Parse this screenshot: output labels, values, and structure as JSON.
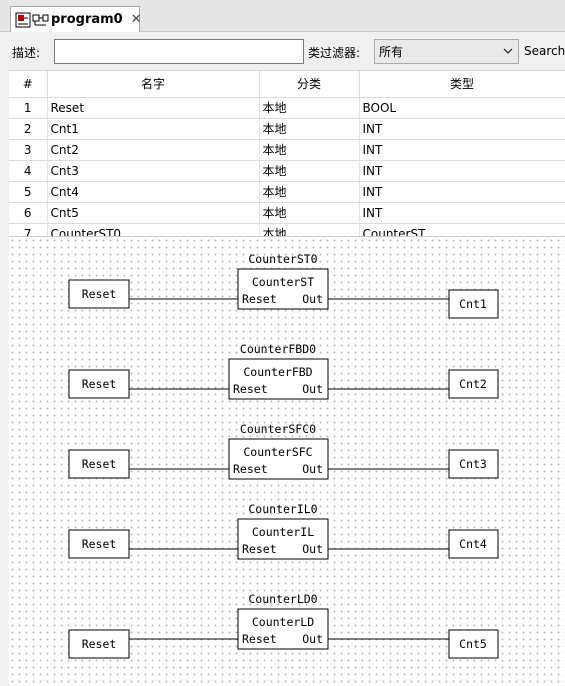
{
  "tab": {
    "label": "program0",
    "close_glyph": "✕"
  },
  "filter": {
    "desc_label": "描述:",
    "desc_value": "",
    "category_label": "类过滤器:",
    "category_value": "所有",
    "search_label": "Search:"
  },
  "table": {
    "headers": [
      "#",
      "名字",
      "分类",
      "类型"
    ],
    "rows": [
      [
        "1",
        "Reset",
        "本地",
        "BOOL"
      ],
      [
        "2",
        "Cnt1",
        "本地",
        "INT"
      ],
      [
        "3",
        "Cnt2",
        "本地",
        "INT"
      ],
      [
        "4",
        "Cnt3",
        "本地",
        "INT"
      ],
      [
        "5",
        "Cnt4",
        "本地",
        "INT"
      ],
      [
        "6",
        "Cnt5",
        "本地",
        "INT"
      ],
      [
        "7",
        "CounterST0",
        "本地",
        "CounterST"
      ]
    ]
  },
  "diagram": {
    "blocks": [
      {
        "instance": "CounterST0",
        "type": "CounterST",
        "in_port": "Reset",
        "out_port": "Out",
        "input": "Reset",
        "output": "Cnt1"
      },
      {
        "instance": "CounterFBD0",
        "type": "CounterFBD",
        "in_port": "Reset",
        "out_port": "Out",
        "input": "Reset",
        "output": "Cnt2"
      },
      {
        "instance": "CounterSFC0",
        "type": "CounterSFC",
        "in_port": "Reset",
        "out_port": "Out",
        "input": "Reset",
        "output": "Cnt3"
      },
      {
        "instance": "CounterIL0",
        "type": "CounterIL",
        "in_port": "Reset",
        "out_port": "Out",
        "input": "Reset",
        "output": "Cnt4"
      },
      {
        "instance": "CounterLD0",
        "type": "CounterLD",
        "in_port": "Reset",
        "out_port": "Out",
        "input": "Reset",
        "output": "Cnt5"
      }
    ]
  }
}
